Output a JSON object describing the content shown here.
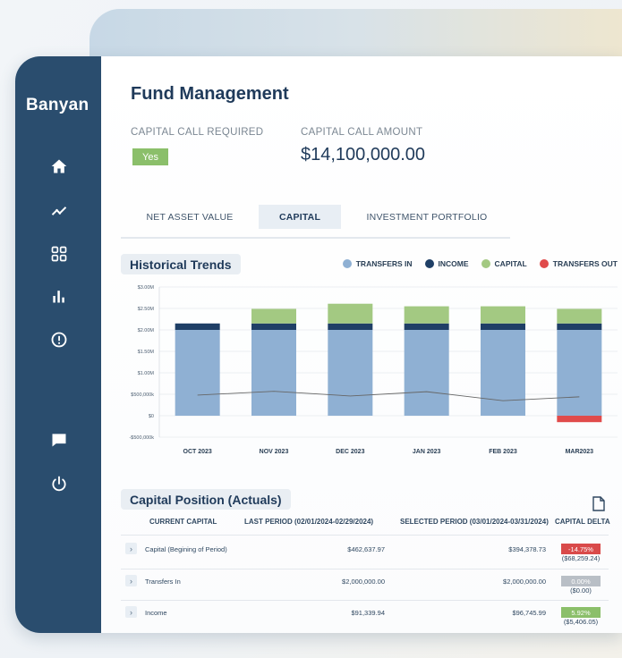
{
  "brand": "Banyan",
  "page_title": "Fund Management",
  "capital_call": {
    "required_label": "CAPITAL CALL REQUIRED",
    "required_value": "Yes",
    "amount_label": "CAPITAL CALL AMOUNT",
    "amount_value": "$14,100,000.00"
  },
  "tabs": [
    "NET ASSET VALUE",
    "CAPITAL",
    "INVESTMENT PORTFOLIO"
  ],
  "active_tab": "CAPITAL",
  "historical": {
    "title": "Historical Trends",
    "legend": [
      "TRANSFERS IN",
      "INCOME",
      "CAPITAL",
      "TRANSFERS OUT"
    ]
  },
  "colors": {
    "sidebar": "#2a4d6e",
    "transfers_in": "#8fb0d3",
    "income": "#1f3f66",
    "capital": "#a3c982",
    "transfers_out": "#e04b4b",
    "line": "#666666"
  },
  "chart_data": {
    "type": "bar",
    "stacked": true,
    "categories": [
      "OCT 2023",
      "NOV 2023",
      "DEC 2023",
      "JAN 2023",
      "FEB 2023",
      "MAR2023"
    ],
    "series": [
      {
        "name": "TRANSFERS IN",
        "values": [
          2000000,
          2000000,
          2000000,
          2000000,
          2000000,
          2000000
        ]
      },
      {
        "name": "INCOME",
        "values": [
          150000,
          150000,
          150000,
          150000,
          150000,
          150000
        ]
      },
      {
        "name": "CAPITAL",
        "values": [
          0,
          340000,
          460000,
          400000,
          400000,
          340000
        ]
      },
      {
        "name": "TRANSFERS OUT",
        "values": [
          0,
          0,
          0,
          0,
          0,
          -150000
        ]
      }
    ],
    "line": [
      480000,
      570000,
      460000,
      560000,
      350000,
      440000
    ],
    "yticks": [
      "$3.00M",
      "$2.50M",
      "$2.00M",
      "$1.50M",
      "$1.00M",
      "$500,000k",
      "$0",
      "-$500,000k"
    ],
    "ylim": [
      -500000,
      3000000
    ],
    "grid": true,
    "legend_position": "top-right"
  },
  "capital_position": {
    "title": "Capital Position (Actuals)",
    "columns": [
      "CURRENT CAPITAL",
      "LAST PERIOD (02/01/2024-02/29/2024)",
      "SELECTED PERIOD (03/01/2024-03/31/2024)",
      "CAPITAL DELTA"
    ],
    "rows": [
      {
        "expander": "›",
        "label": "Capital (Begining of Period)",
        "last": "$462,637.97",
        "selected": "$394,378.73",
        "delta_pct": "-14.75%",
        "delta_amt": "($68,259.24)",
        "delta_color": "#d94a4a"
      },
      {
        "expander": "›",
        "label": "Transfers In",
        "last": "$2,000,000.00",
        "selected": "$2,000,000.00",
        "delta_pct": "0.00%",
        "delta_amt": "($0.00)",
        "delta_color": "#b9bfc6"
      },
      {
        "expander": "›",
        "label": "Income",
        "last": "$91,339.94",
        "selected": "$96,745.99",
        "delta_pct": "5.92%",
        "delta_amt": "($5,406.05)",
        "delta_color": "#8bbf6a"
      }
    ]
  },
  "icons": {
    "nav": [
      "home-icon",
      "trend-icon",
      "grid-icon",
      "bar-chart-icon",
      "alert-icon",
      "chat-icon",
      "power-icon"
    ],
    "export": "document-icon"
  }
}
